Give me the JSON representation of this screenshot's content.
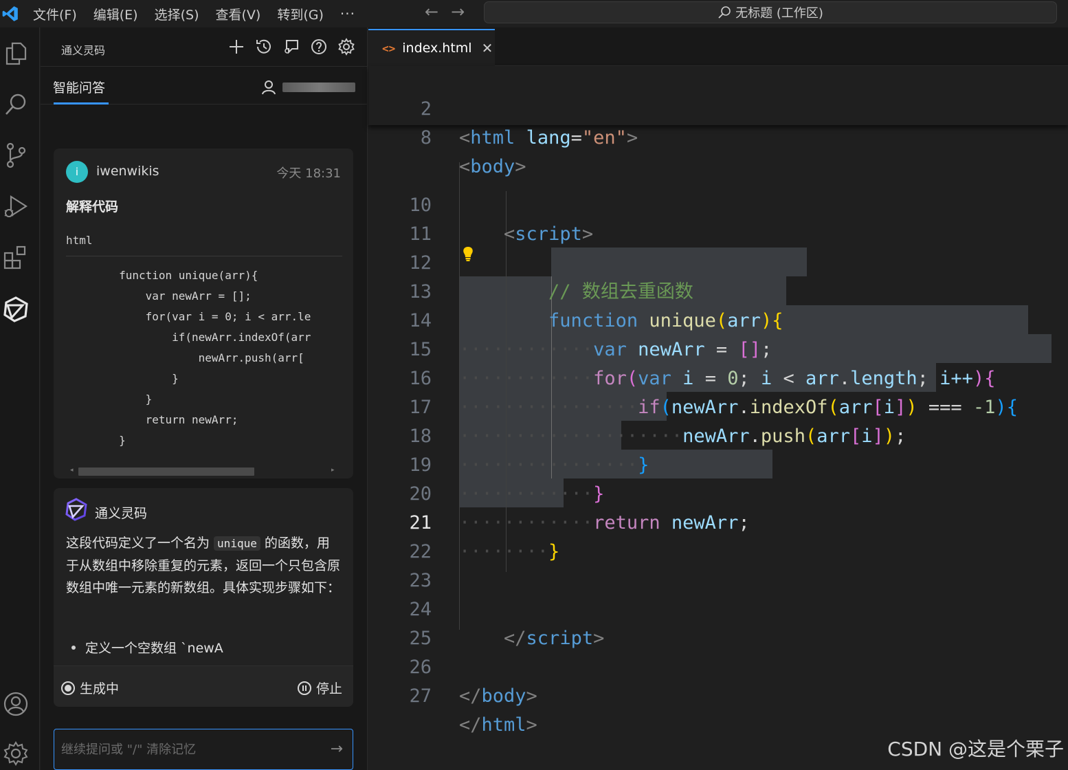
{
  "titlebar": {
    "menus": [
      "文件(F)",
      "编辑(E)",
      "选择(S)",
      "查看(V)",
      "转到(G)"
    ],
    "more": "···",
    "back": "←",
    "forward": "→",
    "search": "无标题 (工作区)"
  },
  "panel": {
    "title": "通义灵码",
    "tab": "智能问答",
    "question": {
      "avatar_letter": "i",
      "user": "iwenwikis",
      "time": "今天 18:31",
      "title": "解释代码",
      "lang": "html",
      "code_lines": [
        "        function unique(arr){",
        "            var newArr = [];",
        "            for(var i = 0; i < arr.le",
        "                if(newArr.indexOf(arr",
        "                    newArr.push(arr[",
        "                }",
        "            }",
        "            return newArr;",
        "        }"
      ]
    },
    "answer": {
      "name": "通义灵码",
      "text_before": "这段代码定义了一个名为 ",
      "code_word": "unique",
      "text_after": " 的函数，用于从数组中移除重复的元素，返回一个只包含原数组中唯一元素的新数组。具体实现步骤如下：",
      "bullet": "定义一个空数组 `newA"
    },
    "generating": "生成中",
    "stop": "停止",
    "input_placeholder": "继续提问或 \"/\" 清除记忆",
    "send": "→"
  },
  "editor": {
    "tab_icon": "<>",
    "tab_name": "index.html",
    "tab_close": "✕",
    "line_numbers": {
      "l2": "2",
      "l8": "8",
      "l10": "10",
      "l11": "11",
      "l12": "12",
      "l13": "13",
      "l14": "14",
      "l15": "15",
      "l16": "16",
      "l17": "17",
      "l18": "18",
      "l19": "19",
      "l20": "20",
      "l21": "21",
      "l22": "22",
      "l23": "23",
      "l24": "24",
      "l25": "25",
      "l26": "26",
      "l27": "27"
    },
    "code": {
      "html_tag": "html",
      "lang_attr": "lang",
      "lang_val": "\"en\"",
      "body_tag": "body",
      "script_tag": "script",
      "comment": "// 数组去重函数",
      "kw_function": "function",
      "fn_unique": "unique",
      "p_arr": "arr",
      "kw_var": "var",
      "v_newArr": "newArr",
      "empty_arr": "[]",
      "kw_for": "for",
      "v_i": "i",
      "n_zero": "0",
      "v_arr": "arr",
      "prop_length": "length",
      "inc": "i++",
      "kw_if": "if",
      "fn_indexOf": "indexOf",
      "strict_eq": "===",
      "n_neg1": "-1",
      "fn_push": "push",
      "kw_return": "return"
    }
  },
  "watermark": "CSDN @这是个栗子"
}
